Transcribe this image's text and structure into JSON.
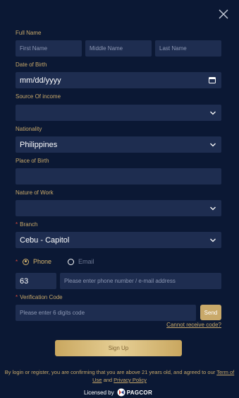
{
  "colors": {
    "background": "#0b1834",
    "field": "#1e2d50",
    "accent": "#c9a96a",
    "required": "#d9493b"
  },
  "labels": {
    "full_name": "Full Name",
    "date_of_birth": "Date of Birth",
    "source_of_income": "Source Of income",
    "nationality": "Nationality",
    "place_of_birth": "Place of Birth",
    "nature_of_work": "Nature of Work",
    "branch": "Branch",
    "verification_code": "Verification Code"
  },
  "fields": {
    "first_name_placeholder": "First Name",
    "middle_name_placeholder": "Middle Name",
    "last_name_placeholder": "Last Name",
    "dob_value": "mm/dd/yyyy",
    "source_of_income_value": "",
    "nationality_value": "Philippines",
    "place_of_birth_value": "",
    "nature_of_work_value": "",
    "branch_value": "Cebu - Capitol",
    "country_code": "63",
    "contact_placeholder": "Please enter phone number / e-mail address",
    "code_placeholder": "Please enter 6 digits code"
  },
  "contact_method": {
    "phone": "Phone",
    "email": "Email",
    "selected": "phone"
  },
  "buttons": {
    "send": "Send",
    "cannot_receive": "Cannot receive code?",
    "sign_up": "Sign Up"
  },
  "footer": {
    "terms_prefix": "By login or register, you are confirming that you are above 21 years old, and agreed to our ",
    "terms_link": "Term of Use",
    "and": " and ",
    "privacy_link": "Privacy Policy",
    "licensed_by": "Licensed by",
    "pagcor": "PAGCOR"
  },
  "icons": {
    "close": "close-icon",
    "calendar": "calendar-icon",
    "dropdown": "chevron-down-icon",
    "pagcor_logo": "pagcor-logo-icon"
  }
}
